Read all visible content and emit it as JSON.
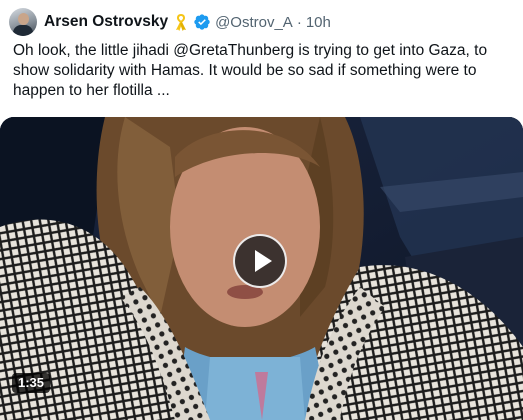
{
  "tweet": {
    "author_name": "Arsen Ostrovsky",
    "handle": "@Ostrov_A",
    "separator": "·",
    "time": "10h",
    "text_lines": [
      "Oh look, the little jihadi @GretaThunberg is trying to get into Gaza, to",
      "show solidarity with Hamas. It would be so sad if something were to",
      "happen to her flotilla ..."
    ],
    "icons": {
      "ribbon": "yellow-ribbon-icon",
      "verified": "verified-badge-icon",
      "play": "play-icon"
    },
    "colors": {
      "verified": "#1d9bf0",
      "ribbon": "#f5c518",
      "secondary_text": "#536471"
    }
  },
  "media": {
    "duration": "1:35"
  }
}
